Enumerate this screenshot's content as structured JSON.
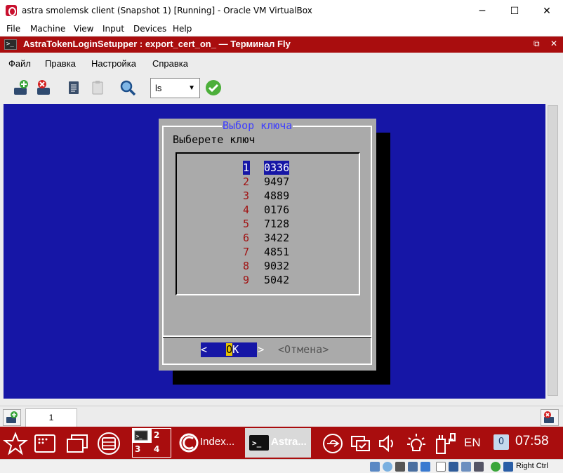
{
  "vbox": {
    "title": "astra smolemsk client (Snapshot 1) [Running] - Oracle VM VirtualBox",
    "controls": {
      "minimize": "─",
      "maximize": "☐",
      "close": "✕"
    },
    "menu": [
      "File",
      "Machine",
      "View",
      "Input",
      "Devices",
      "Help"
    ],
    "host_key": "Right Ctrl"
  },
  "fly_window": {
    "title": "AstraTokenLoginSetupper : export_cert_on_ — Терминал Fly",
    "menu": [
      "Файл",
      "Правка",
      "Настройка",
      "Справка"
    ],
    "toolbar": {
      "command_value": "ls",
      "icons": [
        "new-tab-icon",
        "close-tab-icon",
        "copy-icon",
        "paste-icon",
        "search-icon",
        "run-icon"
      ]
    }
  },
  "dialog": {
    "title": "Выбор ключа",
    "prompt": "Выберете ключ",
    "items": [
      {
        "num": "1",
        "value": "0336",
        "selected": true
      },
      {
        "num": "2",
        "value": "9497"
      },
      {
        "num": "3",
        "value": "4889"
      },
      {
        "num": "4",
        "value": "0176"
      },
      {
        "num": "5",
        "value": "7128"
      },
      {
        "num": "6",
        "value": "3422"
      },
      {
        "num": "7",
        "value": "4851"
      },
      {
        "num": "8",
        "value": "9032"
      },
      {
        "num": "9",
        "value": "5042"
      }
    ],
    "ok_left": "<",
    "ok_hotkey": "O",
    "ok_rest": "K",
    "ok_right": ">",
    "cancel": "<Отмена>"
  },
  "tabbar": {
    "tab_label": "1"
  },
  "panel": {
    "pager": [
      "1",
      "2",
      "3",
      "4"
    ],
    "task_index": "Index...",
    "task_astra": "Astra...",
    "lang": "EN",
    "notifications": "0",
    "clock": "07:58"
  },
  "colors": {
    "vbox_red": "#a90d0e",
    "terminal_blue": "#1616a6",
    "dialog_gray": "#aaaaaa",
    "hotkey_yellow": "#e7c200"
  }
}
